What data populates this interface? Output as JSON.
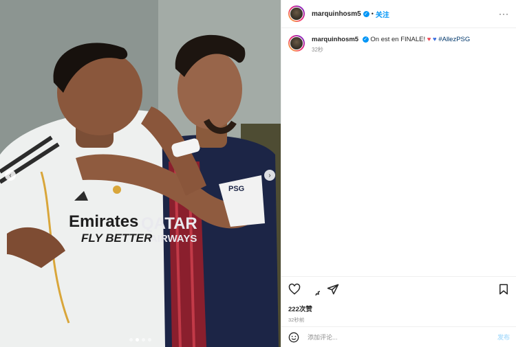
{
  "post": {
    "username": "marquinhosm5",
    "verified": true,
    "separator": "•",
    "follow_label": "关注",
    "more_label": "···"
  },
  "caption": {
    "username": "marquinhosm5",
    "text": "On est en FINALE!",
    "emoji_1": "♥",
    "emoji_2": "♥",
    "hashtag": "#AllezPSG",
    "time": "32秒"
  },
  "media": {
    "prev_icon": "chevron-left-icon",
    "next_icon": "chevron-right-icon",
    "slides": 4,
    "active_slide": 2,
    "prev_glyph": "‹",
    "next_glyph": "›",
    "jersey_left_sponsor": "Emirates",
    "jersey_left_sponsor_2": "FLY BETTER",
    "jersey_right_sponsor": "QATAR",
    "jersey_right_sponsor_2": "AIRWAYS",
    "armband_text": "PSG"
  },
  "actions": {
    "like_icon": "heart-icon",
    "comment_icon": "comment-icon",
    "share_icon": "share-icon",
    "save_icon": "bookmark-icon",
    "likes": "222次赞",
    "posted": "32秒前"
  },
  "comment": {
    "placeholder": "添加评论...",
    "post_label": "发布",
    "emoji_icon": "smiley-icon"
  },
  "colors": {
    "accent": "#0095f6",
    "heart_red": "#ed4956",
    "heart_blue": "#3b6fe0",
    "hashtag": "#00376b",
    "muted": "#8e8e8e"
  }
}
